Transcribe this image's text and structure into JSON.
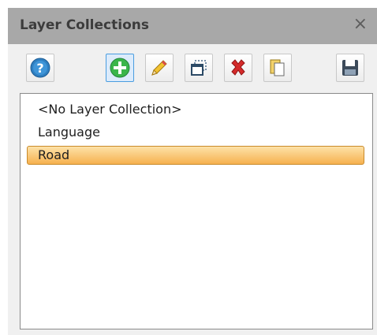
{
  "panel": {
    "title": "Layer Collections",
    "close_glyph": "×"
  },
  "toolbar": {
    "buttons": [
      {
        "name": "help-button",
        "icon": "help-icon",
        "color": "#2f7fc1"
      },
      {
        "name": "add-button",
        "icon": "add-icon",
        "color": "#3ab54a",
        "active": true
      },
      {
        "name": "edit-button",
        "icon": "pencil-icon",
        "color": "#e8a820"
      },
      {
        "name": "duplicate-button",
        "icon": "duplicate-window-icon",
        "color": "#4a6b8a"
      },
      {
        "name": "delete-button",
        "icon": "delete-x-icon",
        "color": "#d42a2a"
      },
      {
        "name": "copy-button",
        "icon": "copy-pages-icon",
        "color": "#e2b93b"
      },
      {
        "name": "save-button",
        "icon": "save-disk-icon",
        "color": "#3c4a5a"
      }
    ]
  },
  "list": {
    "items": [
      {
        "label": "<No Layer Collection>",
        "selected": false
      },
      {
        "label": "Language",
        "selected": false
      },
      {
        "label": "Road",
        "selected": true
      }
    ]
  },
  "colors": {
    "titlebar": "#a8a8a8",
    "selection_gradient_top": "#fde2a8",
    "selection_gradient_bottom": "#f6b14f"
  }
}
